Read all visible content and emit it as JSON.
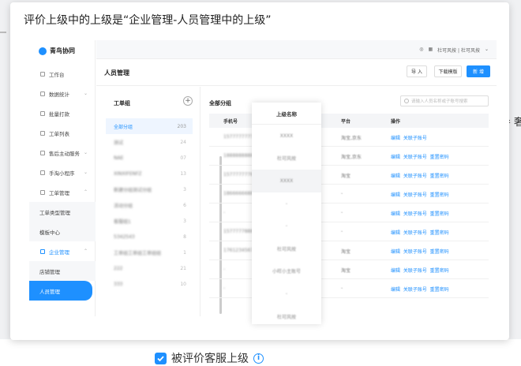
{
  "background": {
    "side_text": "导 奢"
  },
  "popover": {
    "title": "评价上级中的上级是“企业管理-人员管理中的上级”"
  },
  "app": {
    "brand": "青鸟协同",
    "user_label": "杜可风按 | 杜可风按",
    "menu": [
      {
        "label": "工作台",
        "icon": "dashboard-icon"
      },
      {
        "label": "数据统计",
        "icon": "chart-icon",
        "chevron": "⌄"
      },
      {
        "label": "批量打款",
        "icon": "payment-icon"
      },
      {
        "label": "工单列表",
        "icon": "list-icon"
      },
      {
        "label": "售后主动服务",
        "icon": "service-icon",
        "chevron": "⌄"
      },
      {
        "label": "手淘小程序",
        "icon": "miniapp-icon",
        "chevron": "⌄"
      },
      {
        "label": "工单管理",
        "icon": "ticket-icon",
        "chevron": "⌃"
      },
      {
        "label": "工单类型管理",
        "sub": true
      },
      {
        "label": "模板中心",
        "sub": true
      },
      {
        "label": "企业管理",
        "icon": "enterprise-icon",
        "chevron": "⌃",
        "open": true
      },
      {
        "label": "店铺管理",
        "sub": true
      },
      {
        "label": "人员管理",
        "sub": true,
        "active": true
      }
    ],
    "page_title": "人员管理",
    "buttons": {
      "import": "导 入",
      "download": "下载模版",
      "new": "新 增"
    },
    "groups_title": "工单组",
    "groups": [
      {
        "label": "全部分组",
        "count": "203",
        "selected": true
      },
      {
        "label": "测试",
        "count": "24"
      },
      {
        "label": "NAE",
        "count": "07"
      },
      {
        "label": "XINXIFENFZ",
        "count": "13"
      },
      {
        "label": "新建分组测试分组",
        "count": "3"
      },
      {
        "label": "活动分组",
        "count": "6"
      },
      {
        "label": "客服组1",
        "count": "3"
      },
      {
        "label": "5342543",
        "count": "8"
      },
      {
        "label": "工单组工单组工单组组",
        "count": "1"
      },
      {
        "label": "222",
        "count": "21"
      },
      {
        "label": "333",
        "count": "10"
      }
    ],
    "list_title": "全部分组",
    "search_placeholder": "请输入人员名称或子账号搜索",
    "columns": {
      "phone": "手机号",
      "superior": "上级名称",
      "platform": "平台",
      "ops": "操作"
    },
    "rows": [
      {
        "phone": "15777777778",
        "platform": "淘宝,京东",
        "ops": "编辑  关联子账号"
      },
      {
        "phone": "18888888888",
        "platform": "淘宝,京东",
        "ops": "编辑  关联子账号  重置密码"
      },
      {
        "phone": "15777777789",
        "platform": "淘宝",
        "ops": "编辑  关联子账号  重置密码"
      },
      {
        "phone": "18666666888",
        "platform": "-",
        "ops": "编辑  关联子账号  重置密码"
      },
      {
        "phone": "-",
        "platform": "-",
        "ops": "编辑  关联子账号  重置密码"
      },
      {
        "phone": "15777778881",
        "platform": "-",
        "ops": "编辑  关联子账号  重置密码"
      },
      {
        "phone": "17612345678",
        "platform": "淘宝",
        "ops": "编辑  关联子账号  重置密码"
      },
      {
        "phone": "-",
        "platform": "淘宝",
        "ops": "编辑  关联子账号  重置密码"
      },
      {
        "phone": "-",
        "platform": "-",
        "ops": "编辑  关联子账号  重置密码"
      }
    ],
    "superiors": [
      "XXXX",
      "杜可风按",
      "XXXX",
      "-",
      "-",
      "杜可风按",
      "小旺小主账号",
      "-",
      "杜可风按"
    ]
  },
  "checkbox": {
    "label": "被评价客服上级",
    "checked": true
  }
}
